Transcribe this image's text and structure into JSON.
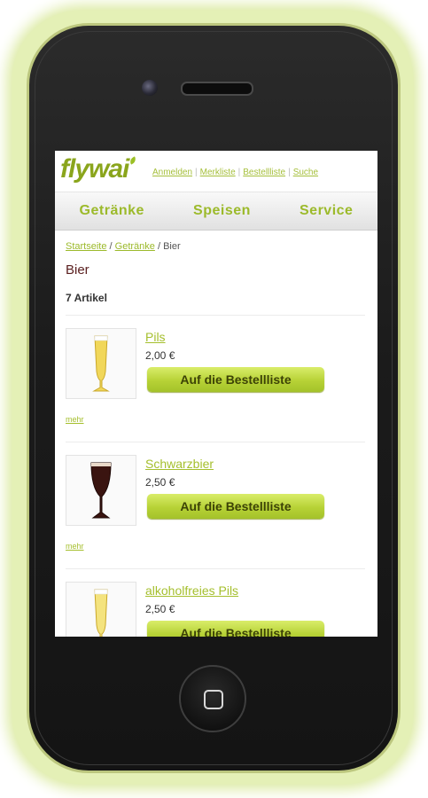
{
  "header": {
    "logo_text": "flywai",
    "links": [
      "Anmelden",
      "Merkliste",
      "Bestellliste",
      "Suche"
    ]
  },
  "nav": {
    "items": [
      "Getränke",
      "Speisen",
      "Service"
    ]
  },
  "breadcrumb": {
    "home": "Startseite",
    "category": "Getränke",
    "current": "Bier",
    "separator": "/"
  },
  "page": {
    "title": "Bier",
    "count": "7 Artikel"
  },
  "products": [
    {
      "name": "Pils",
      "price": "2,00 €",
      "button": "Auf die Bestellliste",
      "more": "mehr"
    },
    {
      "name": "Schwarzbier",
      "price": "2,50 €",
      "button": "Auf die Bestellliste",
      "more": "mehr"
    },
    {
      "name": "alkoholfreies Pils",
      "price": "2,50 €",
      "button": "Auf die Bestellliste",
      "more": ""
    }
  ],
  "colors": {
    "accent": "#9cba2b",
    "button": "#b7d236",
    "heading": "#5a1f1f",
    "glow": "#dbeaa0"
  }
}
